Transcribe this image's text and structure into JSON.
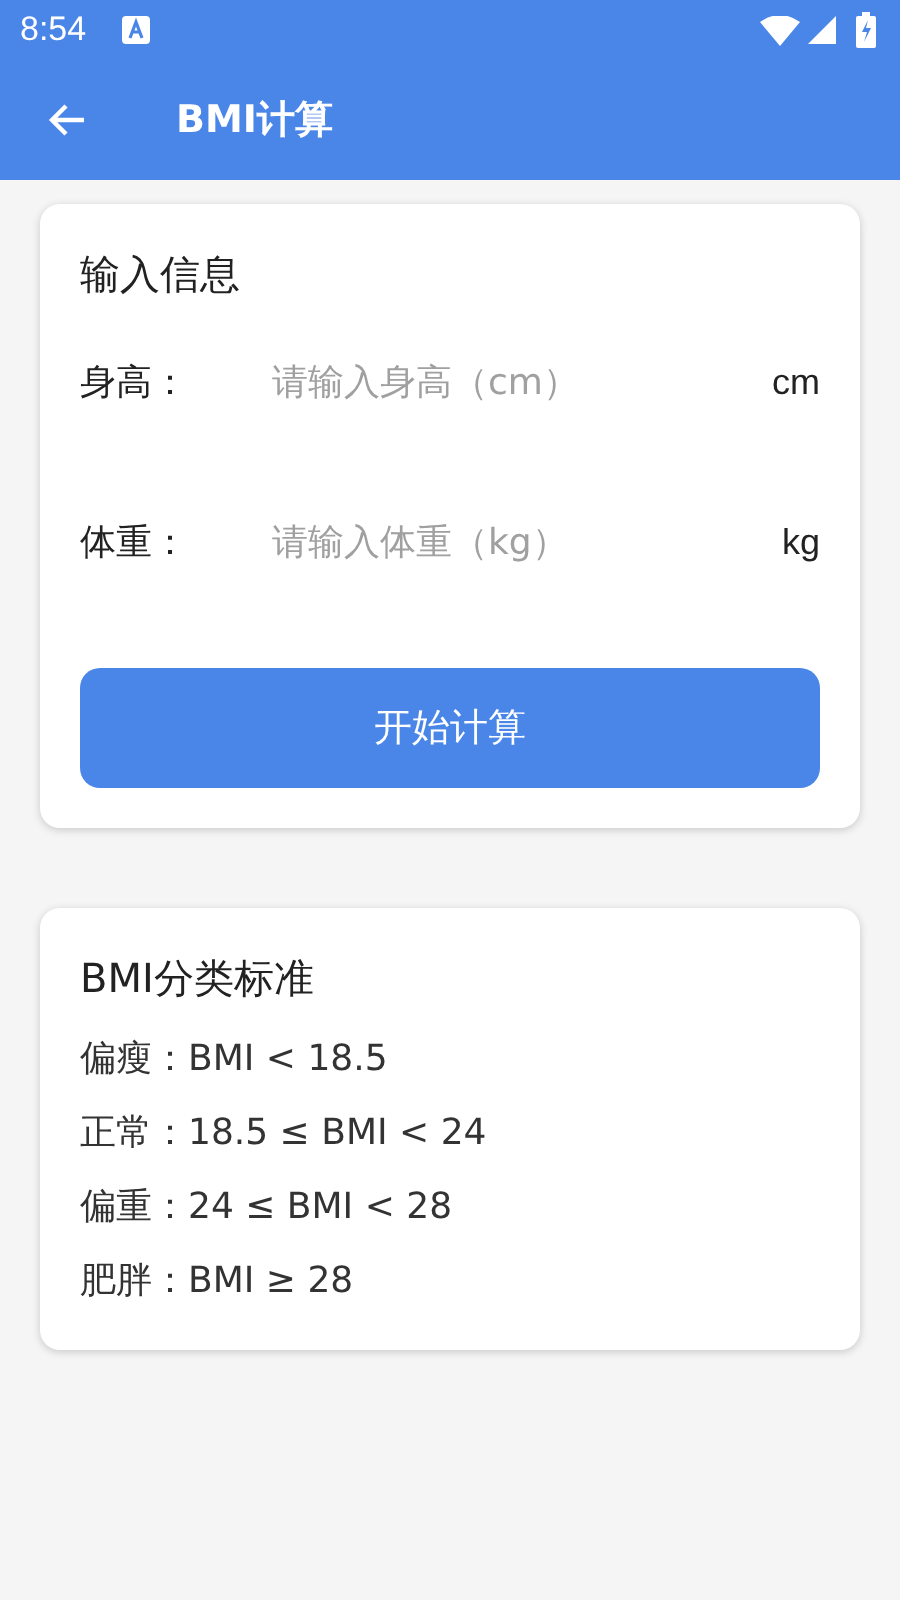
{
  "status_bar": {
    "time": "8:54"
  },
  "app_bar": {
    "title": "BMI计算"
  },
  "input_card": {
    "title": "输入信息",
    "fields": [
      {
        "label": "身高：",
        "placeholder": "请输入身高（cm）",
        "unit": "cm"
      },
      {
        "label": "体重：",
        "placeholder": "请输入体重（kg）",
        "unit": "kg"
      }
    ],
    "button": "开始计算"
  },
  "standards_card": {
    "title": "BMI分类标准",
    "lines": [
      "偏瘦：BMI < 18.5",
      "正常：18.5 ≤ BMI < 24",
      "偏重：24 ≤ BMI < 28",
      "肥胖：BMI ≥ 28"
    ]
  }
}
